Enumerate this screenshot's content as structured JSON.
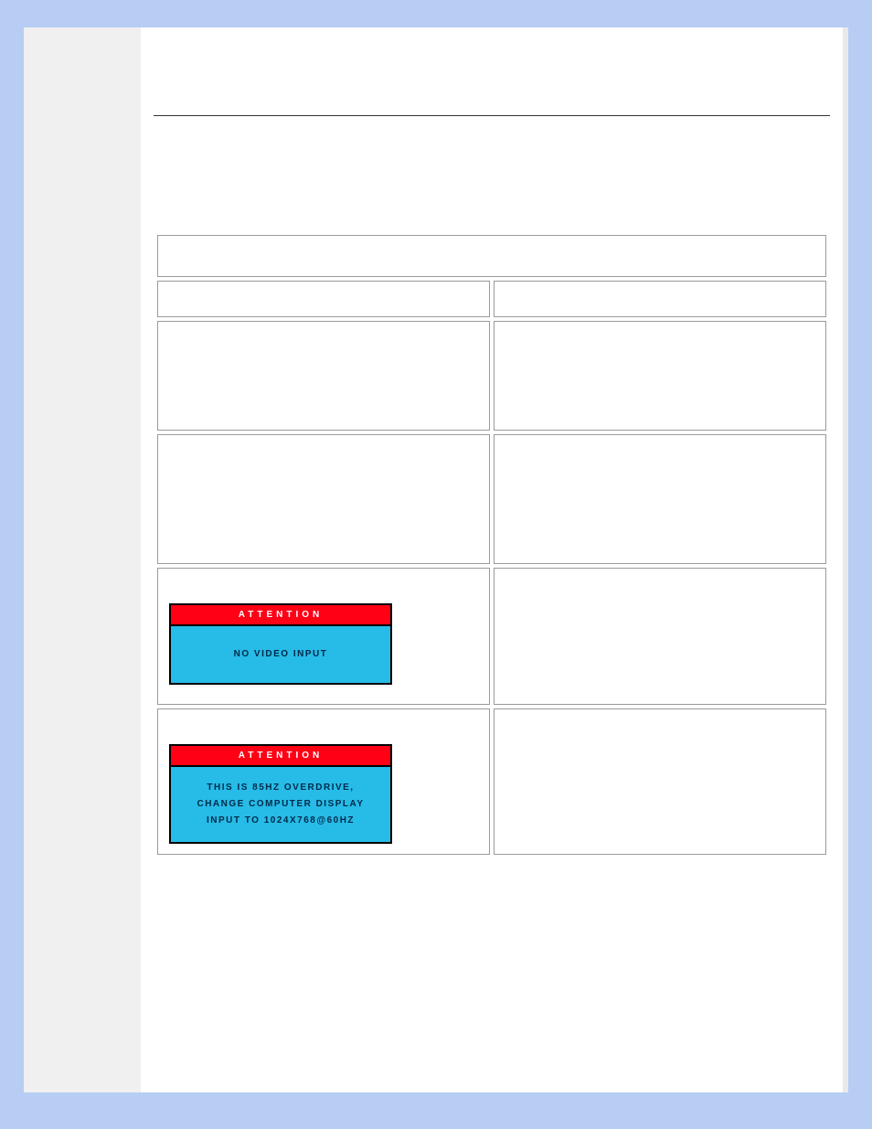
{
  "warnings": {
    "attention_label": "ATTENTION",
    "no_video_input": "NO VIDEO INPUT",
    "overdrive_line1": "THIS IS 85HZ OVERDRIVE,",
    "overdrive_line2": "CHANGE COMPUTER DISPLAY",
    "overdrive_line3": "INPUT TO 1024X768@60HZ"
  }
}
